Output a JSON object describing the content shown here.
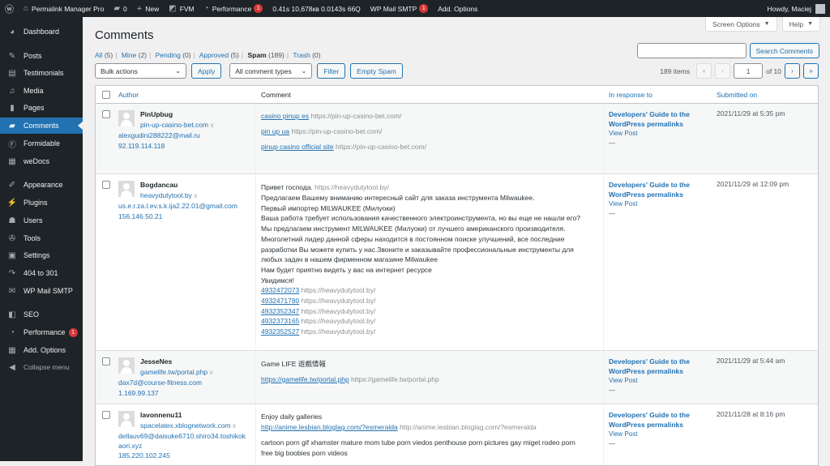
{
  "adminbar": {
    "site_name": "Permalink Manager Pro",
    "comments_count": "0",
    "new_label": "New",
    "fvm_label": "FVM",
    "performance_label": "Performance",
    "performance_badge": "1",
    "stats": "0.41s  10,678кв  0.0143s  66Q",
    "smtp_label": "WP Mail SMTP",
    "smtp_badge": "1",
    "add_options": "Add. Options",
    "howdy": "Howdy, Maciej"
  },
  "sidebar": {
    "items": [
      {
        "label": "Dashboard",
        "icon": "dashboard-icon"
      },
      {
        "label": "Posts",
        "icon": "pin-icon"
      },
      {
        "label": "Testimonials",
        "icon": "testimonial-icon"
      },
      {
        "label": "Media",
        "icon": "media-icon"
      },
      {
        "label": "Pages",
        "icon": "pages-icon"
      },
      {
        "label": "Comments",
        "icon": "comments-icon"
      },
      {
        "label": "Formidable",
        "icon": "formidable-icon"
      },
      {
        "label": "weDocs",
        "icon": "docs-icon"
      },
      {
        "label": "Appearance",
        "icon": "brush-icon"
      },
      {
        "label": "Plugins",
        "icon": "plug-icon"
      },
      {
        "label": "Users",
        "icon": "users-icon"
      },
      {
        "label": "Tools",
        "icon": "wrench-icon"
      },
      {
        "label": "Settings",
        "icon": "settings-icon"
      },
      {
        "label": "404 to 301",
        "icon": "redirect-icon"
      },
      {
        "label": "WP Mail SMTP",
        "icon": "mail-icon"
      },
      {
        "label": "SEO",
        "icon": "seo-icon"
      },
      {
        "label": "Performance",
        "icon": "gauge-icon",
        "badge": "1"
      },
      {
        "label": "Add. Options",
        "icon": "options-icon"
      },
      {
        "label": "Collapse menu",
        "icon": "collapse-icon"
      }
    ]
  },
  "screen_options": "Screen Options",
  "help": "Help",
  "page_title": "Comments",
  "filters": {
    "all": "All",
    "all_count": "(5)",
    "mine": "Mine",
    "mine_count": "(2)",
    "pending": "Pending",
    "pending_count": "(0)",
    "approved": "Approved",
    "approved_count": "(5)",
    "spam": "Spam",
    "spam_count": "(189)",
    "trash": "Trash",
    "trash_count": "(0)"
  },
  "search_button": "Search Comments",
  "tablenav": {
    "bulk_actions": "Bulk actions",
    "apply": "Apply",
    "comment_types": "All comment types",
    "filter": "Filter",
    "empty_spam": "Empty Spam",
    "items": "189 items",
    "first": "«",
    "prev": "‹",
    "current_page": "1",
    "of_pages": "of 10",
    "next": "›",
    "last": "»"
  },
  "columns": {
    "author": "Author",
    "comment": "Comment",
    "response": "In response to",
    "submitted": "Submitted on"
  },
  "rows": [
    {
      "name": "PinUpbug",
      "url": "pin-up-casino-bet.com",
      "email": "alexgudini288222@mail.ru",
      "ip": "92.119.114.118",
      "lines": [
        {
          "link": "casino pinup es",
          "gray": "https://pin-up-casino-bet.com/"
        },
        {
          "link": "pin up ua",
          "gray": "https://pin-up-casino-bet.com/"
        },
        {
          "link": "pinup casino official site",
          "gray": "https://pin-up-casino-bet.com/"
        }
      ],
      "response_title": "Developers' Guide to the WordPress permalinks",
      "view_post": "View Post",
      "dash": "—",
      "submitted": "2021/11/29 at 5:35 pm"
    },
    {
      "name": "Bogdancau",
      "url": "heavydutytool.by",
      "email": "us.e.r.za.l.ev.s.k.ija2.22.01@gmail.com",
      "ip": "156.146.50.21",
      "lines": [
        {
          "text": "Привет господа.",
          "gray": "https://heavydutytool.by/"
        },
        {
          "text": "Предлагаем Вашему вниманию интересный сайт для заказа инструмента Milwaukee."
        },
        {
          "text": "Первый импортер MILWAUKEE (Милуоки)"
        },
        {
          "text": "Ваша работа требует использования качественного электроинструмента, но вы еще не нашли его?"
        },
        {
          "text": "Мы предлагаем инструмент MILWAUKEE (Милуоки) от лучшего американского производителя."
        },
        {
          "text": "Многолетний лидер данной сферы находится в постоянном поиске улучшений, все последние"
        },
        {
          "text": "разработки Вы можете купить у нас.Звоните и заказывайте профессиональные инструменты для"
        },
        {
          "text": "любых задач в нашем фирменном магазине Milwaukee"
        },
        {
          "text": "Нам будет приятно видеть у вас на интернет ресурсе"
        },
        {
          "text": "Увидимся!"
        },
        {
          "link": "4932472073",
          "gray": "https://heavydutytool.by/"
        },
        {
          "link": "4932471780",
          "gray": "https://heavydutytool.by/"
        },
        {
          "link": "4932352347",
          "gray": "https://heavydutytool.by/"
        },
        {
          "link": "4932373165",
          "gray": "https://heavydutytool.by/"
        },
        {
          "link": "4932352527",
          "gray": "https://heavydutytool.by/"
        }
      ],
      "response_title": "Developers' Guide to the WordPress permalinks",
      "view_post": "View Post",
      "dash": "—",
      "submitted": "2021/11/29 at 12:09 pm"
    },
    {
      "name": "JesseNes",
      "url": "gamelife.tw/portal.php",
      "email": "dax7d@course-fitness.com",
      "ip": "1.169.99.137",
      "lines": [
        {
          "text": "Game LIFE 遊戲情報"
        },
        {
          "link": "https://gamelife.tw/portal.php",
          "gray": "https://gamelife.tw/portal.php"
        }
      ],
      "response_title": "Developers' Guide to the WordPress permalinks",
      "view_post": "View Post",
      "dash": "—",
      "submitted": "2021/11/29 at 5:44 am"
    },
    {
      "name": "lavonnenu11",
      "url": "spacelatex.xblognetwork.com",
      "email": "dellauv69@daisuke6710.shiro34.toshikoaori.xyz",
      "email_line1": "dellauv69@daisuke6710.shiro34.toshikok",
      "email_line2": "aori.xyz",
      "ip": "185.220.102.245",
      "lines": [
        {
          "text": "Enjoy daily galleries"
        },
        {
          "link": "http://anime.lesbian.bloglag.com/?esmeralda",
          "gray": "http://anime.lesbian.bloglag.com/?esmeralda"
        },
        {
          "text": "cartoon porn gif xhamster mature mom tube porn viedos penthouse porn pictures gay miget rodeo porn"
        },
        {
          "text": "free big boobies porn videos"
        }
      ],
      "response_title": "Developers' Guide to the WordPress permalinks",
      "view_post": "View Post",
      "dash": "—",
      "submitted": "2021/11/28 at 8:16 pm"
    }
  ]
}
